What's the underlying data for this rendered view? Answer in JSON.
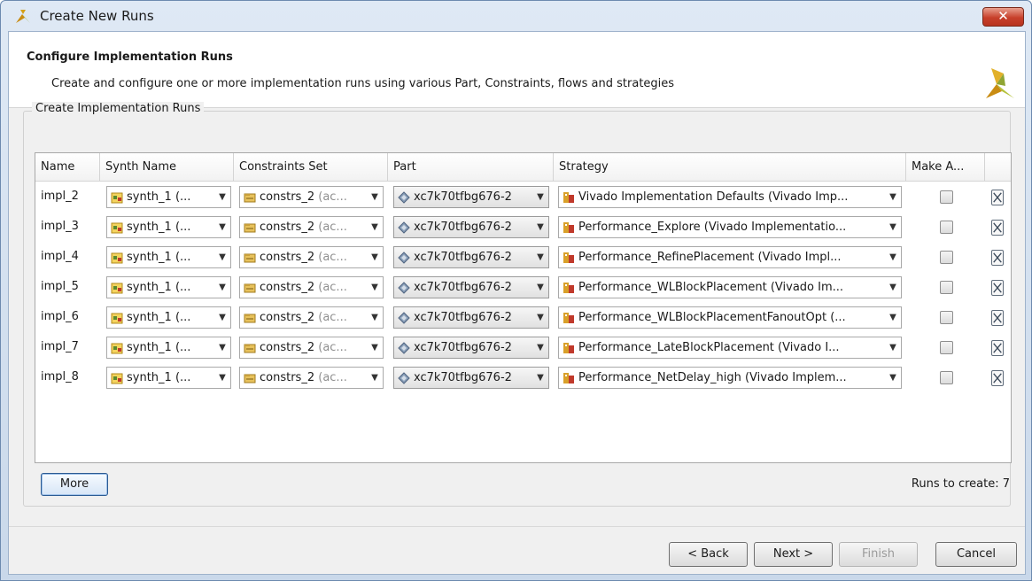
{
  "window": {
    "title": "Create New Runs",
    "close_glyph": "✕"
  },
  "header": {
    "title": "Configure Implementation Runs",
    "subtitle": "Create and configure one or more implementation runs using various Part, Constraints, flows and strategies"
  },
  "group": {
    "title": "Create Implementation Runs"
  },
  "table": {
    "columns": [
      "Name",
      "Synth Name",
      "Constraints Set",
      "Part",
      "Strategy",
      "Make A..."
    ],
    "rows": [
      {
        "name": "impl_2",
        "synth": "synth_1 (...",
        "constrs": "constrs_2",
        "constrs_suffix": "(ac...",
        "part": "xc7k70tfbg676-2",
        "strategy": "Vivado Implementation Defaults (Vivado Imp..."
      },
      {
        "name": "impl_3",
        "synth": "synth_1 (...",
        "constrs": "constrs_2",
        "constrs_suffix": "(ac...",
        "part": "xc7k70tfbg676-2",
        "strategy": "Performance_Explore (Vivado Implementatio..."
      },
      {
        "name": "impl_4",
        "synth": "synth_1 (...",
        "constrs": "constrs_2",
        "constrs_suffix": "(ac...",
        "part": "xc7k70tfbg676-2",
        "strategy": "Performance_RefinePlacement (Vivado Impl..."
      },
      {
        "name": "impl_5",
        "synth": "synth_1 (...",
        "constrs": "constrs_2",
        "constrs_suffix": "(ac...",
        "part": "xc7k70tfbg676-2",
        "strategy": "Performance_WLBlockPlacement (Vivado Im..."
      },
      {
        "name": "impl_6",
        "synth": "synth_1 (...",
        "constrs": "constrs_2",
        "constrs_suffix": "(ac...",
        "part": "xc7k70tfbg676-2",
        "strategy": "Performance_WLBlockPlacementFanoutOpt (..."
      },
      {
        "name": "impl_7",
        "synth": "synth_1 (...",
        "constrs": "constrs_2",
        "constrs_suffix": "(ac...",
        "part": "xc7k70tfbg676-2",
        "strategy": "Performance_LateBlockPlacement (Vivado I..."
      },
      {
        "name": "impl_8",
        "synth": "synth_1 (...",
        "constrs": "constrs_2",
        "constrs_suffix": "(ac...",
        "part": "xc7k70tfbg676-2",
        "strategy": "Performance_NetDelay_high (Vivado Implem..."
      }
    ]
  },
  "more_button": "More",
  "runs_to_create": "Runs to create: 7",
  "buttons": {
    "back": "< Back",
    "next": "Next >",
    "finish": "Finish",
    "cancel": "Cancel"
  }
}
